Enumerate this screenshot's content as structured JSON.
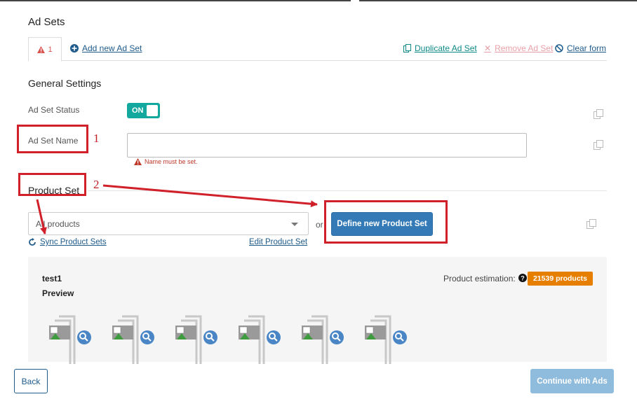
{
  "header": {
    "title": "Ad Sets"
  },
  "tabs": {
    "active_label": "1",
    "add_new": "Add new Ad Set",
    "duplicate": "Duplicate Ad Set",
    "remove": "Remove Ad Set",
    "clear": "Clear form"
  },
  "general": {
    "title": "General Settings",
    "status_label": "Ad Set Status",
    "status_value": "ON",
    "name_label": "Ad Set Name",
    "name_value": "",
    "name_error": "Name must be set."
  },
  "product_set": {
    "title": "Product Set",
    "select_value": "All products",
    "or_text": "or",
    "define_button": "Define new Product Set",
    "sync_link": "Sync Product Sets",
    "edit_link": "Edit Product Set"
  },
  "preview_panel": {
    "set_name": "test1",
    "preview_label": "Preview",
    "estimation_label": "Product estimation:",
    "estimation_value": "21539 products"
  },
  "annotations": {
    "num1": "1",
    "num2": "2"
  },
  "footer": {
    "back": "Back",
    "continue": "Continue with Ads"
  },
  "colors": {
    "accent": "#337ab7",
    "toggle": "#13a89e",
    "badge": "#e67e00",
    "annotation": "#d0202a"
  }
}
